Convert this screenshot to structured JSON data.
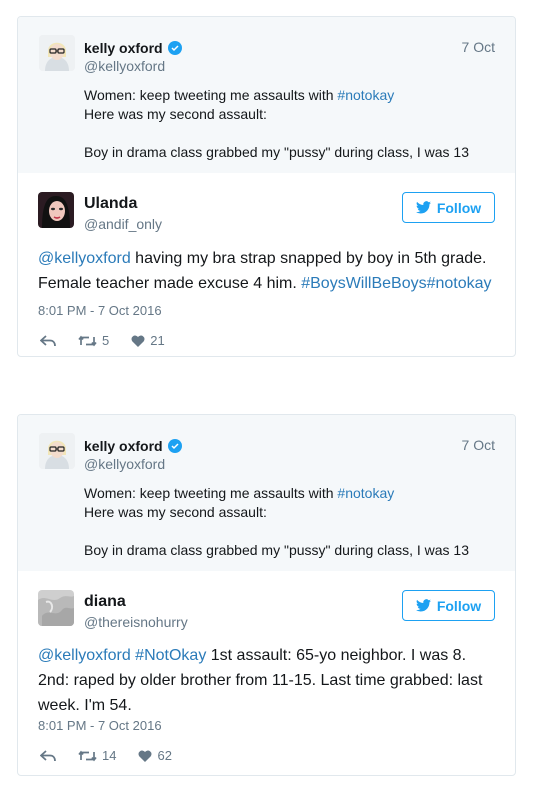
{
  "tweets": [
    {
      "quoted": {
        "name": "kelly oxford",
        "handle": "@kellyoxford",
        "date": "7 Oct",
        "line1_prefix": "Women: keep tweeting me assaults with ",
        "line1_hashtag": "#notokay",
        "line2": "Here was my second assault:",
        "line3": "",
        "line4": "Boy in drama class grabbed my \"pussy\" during class, I was 13"
      },
      "reply": {
        "name": "Ulanda",
        "handle": "@andif_only",
        "follow_label": "Follow",
        "mention": "@kellyoxford",
        "text_part1": " having my bra strap snapped by boy in 5th grade. Female teacher made excuse 4 him. ",
        "tag1": "#BoysWillBeBoys",
        "tag2": "#notokay",
        "timestamp": "8:01 PM - 7 Oct 2016",
        "retweets": "5",
        "likes": "21"
      }
    },
    {
      "quoted": {
        "name": "kelly oxford",
        "handle": "@kellyoxford",
        "date": "7 Oct",
        "line1_prefix": "Women: keep tweeting me assaults with ",
        "line1_hashtag": "#notokay",
        "line2": "Here was my second assault:",
        "line3": "",
        "line4": "Boy in drama class grabbed my \"pussy\" during class, I was 13"
      },
      "reply": {
        "name": "diana",
        "handle": "@thereisnohurry",
        "follow_label": "Follow",
        "mention": "@kellyoxford",
        "tag1": "#NotOkay",
        "text_part1": " 1st assault: 65-yo neighbor. I was 8. 2nd: raped by older brother from 11-15. Last time grabbed: last week. I'm 54.",
        "timestamp": "8:01 PM - 7 Oct 2016",
        "retweets": "14",
        "likes": "62"
      }
    }
  ],
  "colors": {
    "link": "#2b7bb9",
    "twitter_blue": "#1da1f2",
    "muted": "#657786",
    "border": "#e1e8ed",
    "quote_bg": "#f5f8fa"
  },
  "icons": [
    "verified-badge-icon",
    "twitter-bird-icon",
    "reply-icon",
    "retweet-icon",
    "heart-icon"
  ]
}
